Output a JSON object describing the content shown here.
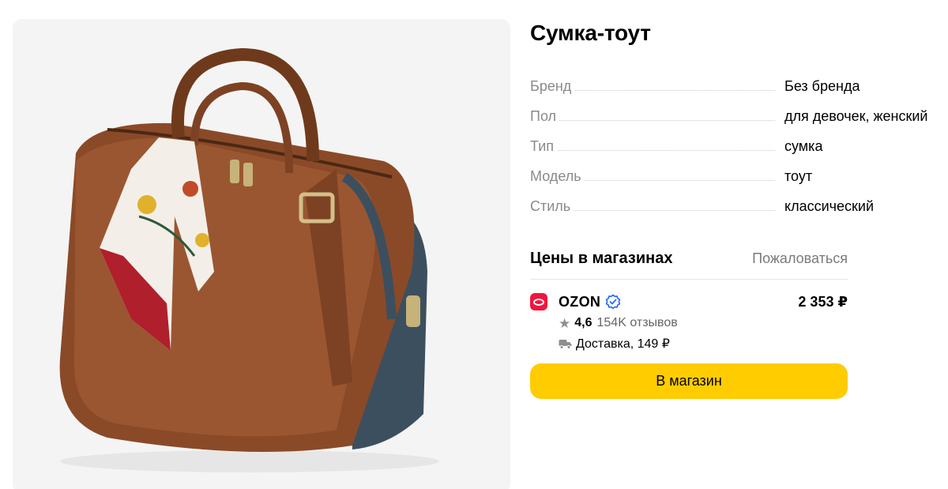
{
  "product": {
    "title": "Сумка-тоут",
    "image_alt": "brown leather tote bag with navy panel and floral scarf"
  },
  "specs": [
    {
      "key": "Бренд",
      "value": "Без бренда"
    },
    {
      "key": "Пол",
      "value": "для девочек, женский"
    },
    {
      "key": "Тип",
      "value": "сумка"
    },
    {
      "key": "Модель",
      "value": "тоут"
    },
    {
      "key": "Стиль",
      "value": "классический"
    }
  ],
  "prices": {
    "title": "Цены в магазинах",
    "complain_label": "Пожаловаться",
    "offers": [
      {
        "shop": "OZON",
        "price": "2 353 ₽",
        "rating": "4,6",
        "reviews": "154K отзывов",
        "delivery": "Доставка, 149 ₽",
        "button_label": "В магазин"
      }
    ]
  },
  "colors": {
    "accent_button": "#ffcc00",
    "shop_brand": "#f0163e",
    "verified": "#2a6df4"
  }
}
